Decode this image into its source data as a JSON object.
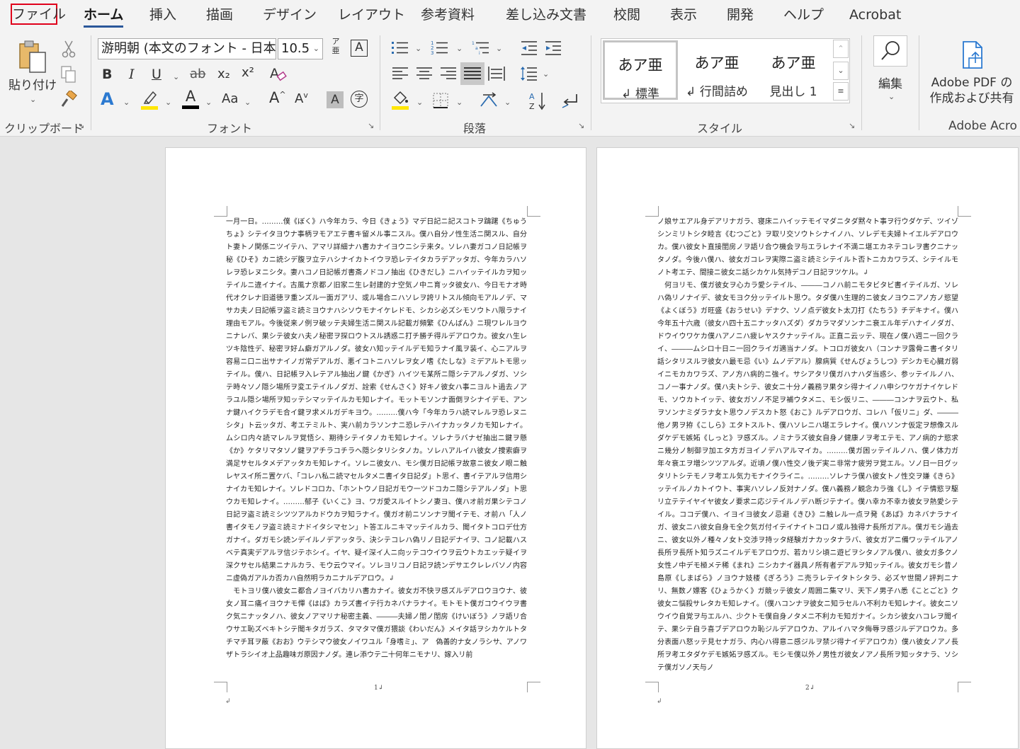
{
  "tabs": {
    "file": "ファイル",
    "home": "ホーム",
    "insert": "挿入",
    "draw": "描画",
    "design": "デザイン",
    "layout": "レイアウト",
    "references": "参考資料",
    "mailings": "差し込み文書",
    "review": "校閲",
    "view": "表示",
    "developer": "開発",
    "help": "ヘルプ",
    "acrobat": "Acrobat"
  },
  "clipboard": {
    "paste_label": "貼り付け",
    "group_label": "クリップボード"
  },
  "font": {
    "font_name": "游明朝 (本文のフォント - 日本",
    "font_size": "10.5",
    "phonetic_top": "ア",
    "phonetic_bottom": "亜",
    "enclose": "A",
    "bold": "B",
    "italic": "I",
    "underline": "U",
    "strike": "ab",
    "subscript": "x₂",
    "superscript": "x²",
    "text_effect": "A",
    "font_color": "A",
    "change_case": "Aa",
    "grow": "A",
    "shrink": "A",
    "char_shading": "A",
    "enclose_char": "字",
    "group_label": "フォント",
    "highlight_color": "#ffe600",
    "font_color_value": "#000000"
  },
  "paragraph": {
    "group_label": "段落"
  },
  "styles": {
    "items": [
      {
        "sample": "あア亜",
        "name": "↲ 標準"
      },
      {
        "sample": "あア亜",
        "name": "↲ 行間詰め"
      },
      {
        "sample": "あア亜",
        "name": "見出し 1"
      }
    ],
    "group_label": "スタイル"
  },
  "editing": {
    "label": "編集"
  },
  "adobe": {
    "label_line1": "Adobe PDF の",
    "label_line2": "作成および共有",
    "group_label": "Adobe Acro"
  },
  "page1": {
    "text": "一月一日。………僕《ぼく》ハ今年カラ、今日《きょう》マデ日記ニ記スコトヲ躊躇《ちゅうちょ》シテイタヨウナ事柄ヲモアエテ書キ留メル事ニスル。僕ハ自分ノ性生活ニ関スル、自分ト妻トノ関係ニツイテハ、アマリ詳細ナハ書カナイヨウニシテ来タ。ソレハ妻ガコノ日記帳ヲ秘《ひそ》カニ読シデ腹ヲ立テハシナイカトイウヲ恐レテイタカラデアッタガ、今年カラハソレヲ恐レヌニシタ。妻ハコノ日記帳ガ書斎ノドコノ抽出《ひきだし》ニハイッテイルカヲ知ッテイルニ違イナイ。古風ナ京都ノ旧家ニ生レ封建的ナ空気ノ中ニ育ッタ彼女ハ、今日モナオ時代オクレナ旧道徳ヲ重ンズル一面ガアリ、或ル場合ニハソレヲ誇リトスル傾向モアルノデ、マサカ夫ノ日記帳ヲ盗ミ読ミヨウナハシソウモナイケレドモ、シカシ必ズシモソウトハ限ラナイ理由モアル。今後従来ノ例ヲ破ッテ夫婦生活ニ関スル記載ガ頻繁《ひんぱん》ニ現ワレルヨウニナレバ、果シテ彼女ハ夫ノ秘密ヲ探ロウトスル誘惑ニ打チ勝チ得ルデアロウカ。彼女ハ生レツキ陰性デ、秘密ヲ好ム癖ガアルノダ。彼女ハ知ッテイルデモ知ラナイ風ヲ装イ、心ニアルヲ容易ニ口ニ出サナイノガ常デアルガ、悪イコトニハソレヲ女ノ嗜《たしな》ミデアルトモ思ッテイル。僕ハ、日記帳ヲ入レテアル抽出ノ鍵《かぎ》ハイツモ某所ニ隠シテアルノダガ、ソシテ時々ソノ隠シ場所ヲ変エテイルノダガ、詮索《せんさく》好キノ彼女ハ事ニヨルト過去ノアラユル隠シ場所ヲ知ッテシマッテイルカモ知レナイ。モットモソンナ面倒ヲシナイデモ、アンナ鍵ハイクラデモ合イ鍵ヲ求メルガデキヨウ。………僕ハ今「今年カラハ読マレルヲ恐レヌニシタ」ト云ッタガ、考エテミルト、実ハ前カラソンナニ恐レテハイナカッタノカモ知レナイ。ムシロ内々読マレルヲ覚悟シ、期待シテイタノカモ知レナイ。ソレナラバナゼ抽出ニ鍵ヲ懸《か》ケタリマタソノ鍵ヲアチラコチラヘ隠シタリシタノカ。ソレハアルイハ彼女ノ捜索癖ヲ満足サセルタメデアッタカモ知レナイ。ソレニ彼女ハ、モシ僕ガ日記帳ヲ故意ニ彼女ノ眼ニ触レヤスイ所ニ置ケバ、「コレハ私ニ読マセルタメニ書イタ日記ダ」ト思イ、書イテアルヲ信用シナイカモ知レナイ。ソレドコロカ、「ホントウノ日記ガモウ一ツドコカニ隠シテアルノダ」ト思ウカモ知レナイ。………郁子《いくこ》ヨ、ワガ愛スルイトシノ妻ヨ、僕ハオ前ガ果シテコノ日記ヲ盗ミ読ミシツツアルカドウカヲ知ラナイ。僕ガオ前ニソンナヲ聞イテモ、オ前ハ「人ノ書イタモノヲ盗ミ読ミナドイタシマセン」ト答エルニキマッテイルカラ、聞イタトコロデ仕方ガナイ。ダガモシ読ンデイルノデアッタラ、決シテコレハ偽リノ日記デナイヲ、コノ記載ハスベテ真実デアルヲ信ジテホシイ。イヤ、疑イ深イ人ニ向ッテコウイウヲ云ウトカエッテ疑イヲ深クサセル結果ニナルカラ、モウ云ウマイ。ソレヨリコノ日記ヲ読ンデサエクレレバソノ内容ニ虚偽ガアルカ否カハ自然明ラカニナルデアロウ。↲\n　モトヨリ僕ハ彼女ニ都合ノヨイバカリハ書カナイ。彼女ガ不快ヲ感ズルデアロウヨウナ、彼女ノ耳ニ痛イヨウナモ憚《はば》カラズ書イテ行カネバナラナイ。モトモト僕ガコウイウヲ書ク気ニナッタノハ、彼女ノアマリナ秘密主義、―――夫婦ノ閨ノ閨房《けいぼう》ノヲ語リ合ウサエ恥ズベキトシテ聞キタガラズ、タマタマ僕ガ猥談《わいだん》メイタ話ヲシカケルトタチマチ耳ヲ蔽《おお》ウテシマウ彼女ノイワユル「身嗜ミ」、ア　偽善的ナ女ノラシサ、アノワザトラシイオ上品趣味ガ原因ナノダ。連レ添ウテ二十何年ニモナリ、嫁入リ前",
    "page_number": "1↲",
    "trailing_mark": "↲"
  },
  "page2": {
    "text": "ノ娘サエアル身デアリナガラ、寝床ニハイッテモイマダニタダ黙々ト事ヲ行ウダケデ、ツイゾシンミリトシタ睦言《むつごと》ヲ取リ交ソウトシナイノハ、ソレデモ夫婦トイエルデアロウカ。僕ハ彼女ト直接閨房ノヲ語リ合ウ機会ヲ与エラレナイ不満ニ堪エカネテコレヲ書クニナッタノダ。今後ハ僕ハ、彼女ガコレヲ実際ニ盗ミ読ミシテイルト否トニカカワラズ、シテイルモノト考エテ、間接ニ彼女ニ話シカケル気持デコノ日記ヲツケル。↲\n　何ヨリモ、僕ガ彼女ヲ心カラ愛シテイル、―――コノハ前ニモタビタビ書イテイルガ、ソレハ偽リノナイデ、彼女モヨク分ッテイルト思ウ。タダ僕ハ生理的ニ彼女ノヨウニアノ方ノ慾望《よくぼう》ガ旺盛《おうせい》デナク、ソノ点デ彼女ト太刀打《たちう》チデキナイ。僕ハ今年五十六歳（彼女ハ四十五ニナッタハズダ）ダカラマダソンナニ衰エル年デハナイノダガ、ドウイウワケカ僕ハアノニハ疲レヤスクナッテイル。正直ニ云ッテ、現在ノ僕ハ週ニ一回クライ、―――ムシロ十日ニ一回クライガ適当ナノダ。トコロガ彼女ハ（コンナヲ露骨ニ書イタリ話シタリスルヲ彼女ハ最モ忌《い》ムノデアル）腺病質《せんびょうしつ》デシカモ心臓ガ弱イニモカカワラズ、アノ方ハ病的ニ強イ。サシアタリ僕ガハナハダ当惑シ、参ッテイルノハ、コノ一事ナノダ。僕ハ夫トシテ、彼女ニ十分ノ義務ヲ果タシ得ナイノハ申シワケガナイケレドモ、ソウカトイッテ、彼女ガソノ不足ヲ補ウタメニ、モシ仮リニ、―――コンナヲ云ウト、私ヲソンナミダラナ女ト思ウノデスカト怒《おこ》ルデアロウガ、コレハ「仮リニ」ダ、―――他ノ男ヲ拵《こしら》エタトスルト、僕ハソレニハ堪エラレナイ。僕ハソンナ仮定ヲ想像スルダケデモ嫉妬《しっと》ヲ感ズル。ノミナラズ彼女自身ノ健康ノヲ考エテモ、アノ病的ナ慾求ニ幾分ノ制御ヲ加エタ方ガヨイノデハアルマイカ。………僕ガ困ッテイルノハ、僕ノ体力ガ年々衰エヲ増シツツアルダ。近頃ノ僕ハ性交ノ後デ実ニ非常ナ疲労ヲ覚エル。ソノ日一日グッタリトシテモノヲ考エル気力モナイクライニ。………ソレナラ僕ハ彼女トノ性交ヲ嫌《きら》ッテイルノカトイウト、事実ハソレノ反対ナノダ。僕ハ義務ノ観念カラ強《し》イテ情慾ヲ駆リ立テテイヤイヤ彼女ノ要求ニ応ジテイルノデハ断ジテナイ。僕ハ幸カ不幸カ彼女ヲ熱愛シテイル。ココデ僕ハ、イヨイヨ彼女ノ忌避《きひ》ニ触レル一点ヲ発《あば》カネバナラナイガ、彼女ニハ彼女自身モ全ク気ガ付イテイナイトコロノ或ル独得ナ長所ガアル。僕ガモシ過去ニ、彼女以外ノ種々ノ女ト交渉ヲ持ッタ経験ガナカッタナラバ、彼女ガアニ備ワッテイルアノ長所ヲ長所ト知ラズニイルデモアロウガ、若カリシ頃ニ遊ビヲシタノアル僕ハ、彼女ガ多クノ女性ノ中デモ極メテ稀《まれ》ニシカナイ器具ノ所有者デアルヲ知ッテイル。彼女ガモシ昔ノ島原《しまばら》ノヨウナ妓楼《ぎろう》ニ売ラレテイタトシタラ、必ズヤ世間ノ評判ニナリ、無数ノ嫖客《ひょうかく》ガ競ッテ彼女ノ周囲ニ集マリ、天下ノ男子ハ悉《ことごと》ク彼女ニ悩殺サレタカモ知レナイ。（僕ハコンナヲ彼女ニ知ラセルハ不利カモ知レナイ。彼女ニソウイウ自覚ヲ与エルハ、少クトモ僕自身ノタメニ不利カモ知ガナイ。シカシ彼女ハコレヲ聞イテ、果シテ自ラ喜ブデアロウカ恥ジルデアロウカ、アルイハマタ侮辱ヲ感ジルデアロウカ。多分表面ハ怒ッテ見セナガラ、内心ハ得意ニ感ジルヲ禁ジ得ナイデアロウカ）僕ハ彼女ノアノ長所ヲ考エタダケデモ嫉妬ヲ感ズル。モシモ僕以外ノ男性ガ彼女ノアノ長所ヲ知ッタナラ、ソシテ僕ガソノ天与ノ",
    "page_number": "2↲",
    "trailing_mark": "↲"
  }
}
